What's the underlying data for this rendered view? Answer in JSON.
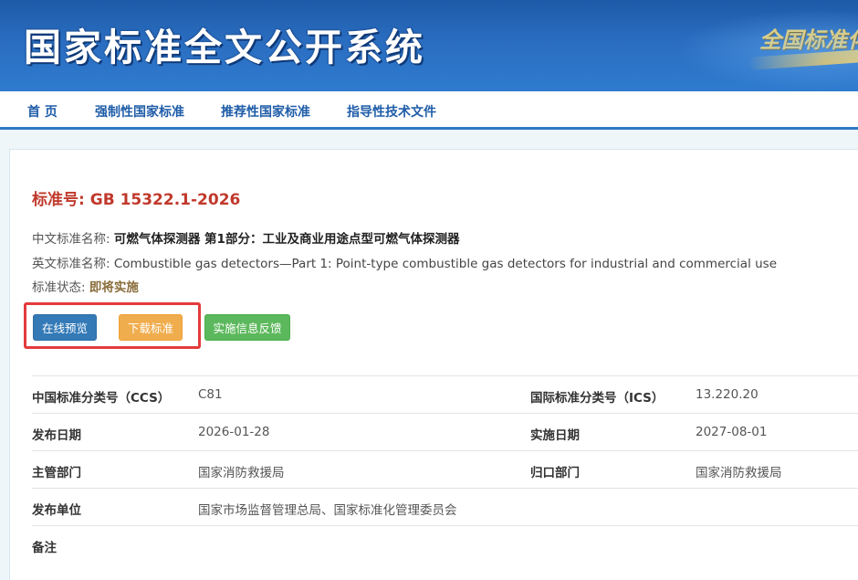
{
  "header": {
    "title": "国家标准全文公开系统",
    "subtitle": "全国标准化"
  },
  "nav": {
    "items": [
      "首 页",
      "强制性国家标准",
      "推荐性国家标准",
      "指导性技术文件"
    ]
  },
  "standard": {
    "number_label": "标准号:",
    "number": "GB 15322.1-2026",
    "cn_name_label": "中文标准名称:",
    "cn_name": "可燃气体探测器 第1部分：工业及商业用途点型可燃气体探测器",
    "en_name_label": "英文标准名称:",
    "en_name": "Combustible gas detectors—Part 1: Point-type combustible gas detectors for industrial and commercial use",
    "status_label": "标准状态:",
    "status": "即将实施"
  },
  "actions": {
    "preview": "在线预览",
    "download": "下载标准",
    "feedback": "实施信息反馈"
  },
  "details": {
    "rows": [
      {
        "label1": "中国标准分类号（CCS）",
        "value1": "C81",
        "label2": "国际标准分类号（ICS）",
        "value2": "13.220.20"
      },
      {
        "label1": "发布日期",
        "value1": "2026-01-28",
        "label2": "实施日期",
        "value2": "2027-08-01"
      },
      {
        "label1": "主管部门",
        "value1": "国家消防救援局",
        "label2": "归口部门",
        "value2": "国家消防救援局"
      },
      {
        "label1": "发布单位",
        "value1": "国家市场监督管理总局、国家标准化管理委员会",
        "label2": "",
        "value2": ""
      },
      {
        "label1": "备注",
        "value1": "",
        "label2": "",
        "value2": ""
      }
    ]
  },
  "colors": {
    "banner": "#2a6dc0",
    "nav_text": "#1f5da8",
    "standard_number": "#c0392b",
    "highlight_box": "#e43b3b",
    "btn_preview": "#337ab7",
    "btn_download": "#f0ad4e",
    "btn_feedback": "#5cb85c"
  }
}
